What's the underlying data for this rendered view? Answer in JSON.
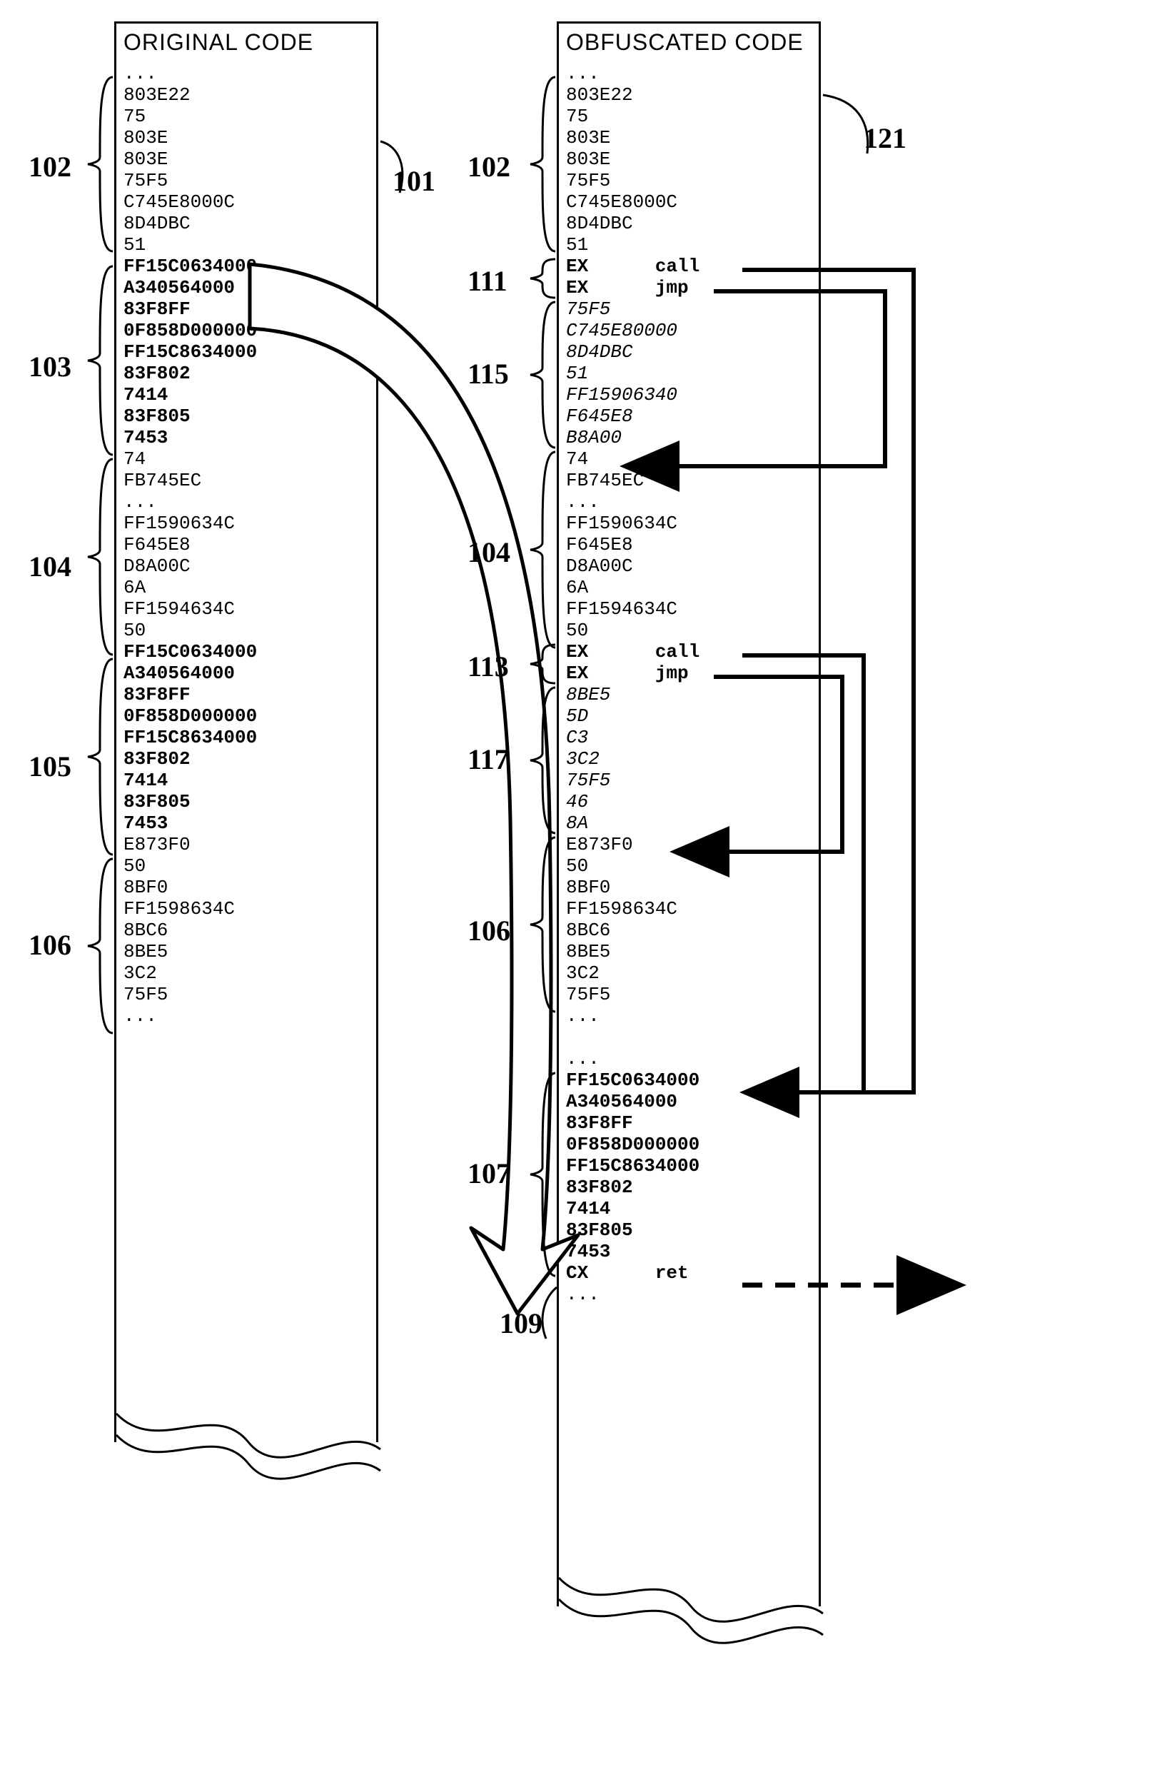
{
  "left_panel": {
    "title": "ORIGINAL CODE",
    "lines": [
      {
        "t": "...",
        "s": ""
      },
      {
        "t": "803E22",
        "s": ""
      },
      {
        "t": "75",
        "s": ""
      },
      {
        "t": "803E",
        "s": ""
      },
      {
        "t": "803E",
        "s": ""
      },
      {
        "t": "75F5",
        "s": ""
      },
      {
        "t": "C745E8000C",
        "s": ""
      },
      {
        "t": "8D4DBC",
        "s": ""
      },
      {
        "t": "51",
        "s": ""
      },
      {
        "t": "FF15C0634000",
        "s": "bold"
      },
      {
        "t": "A340564000",
        "s": "bold"
      },
      {
        "t": "83F8FF",
        "s": "bold"
      },
      {
        "t": "0F858D000000",
        "s": "bold"
      },
      {
        "t": "FF15C8634000",
        "s": "bold"
      },
      {
        "t": "83F802",
        "s": "bold"
      },
      {
        "t": "7414",
        "s": "bold"
      },
      {
        "t": "83F805",
        "s": "bold"
      },
      {
        "t": "7453",
        "s": "bold"
      },
      {
        "t": "74",
        "s": ""
      },
      {
        "t": "FB745EC",
        "s": ""
      },
      {
        "t": "...",
        "s": ""
      },
      {
        "t": "FF1590634C",
        "s": ""
      },
      {
        "t": "F645E8",
        "s": ""
      },
      {
        "t": "D8A00C",
        "s": ""
      },
      {
        "t": "6A",
        "s": ""
      },
      {
        "t": "FF1594634C",
        "s": ""
      },
      {
        "t": "50",
        "s": ""
      },
      {
        "t": "FF15C0634000",
        "s": "bold"
      },
      {
        "t": "A340564000",
        "s": "bold"
      },
      {
        "t": "83F8FF",
        "s": "bold"
      },
      {
        "t": "0F858D000000",
        "s": "bold"
      },
      {
        "t": "FF15C8634000",
        "s": "bold"
      },
      {
        "t": "83F802",
        "s": "bold"
      },
      {
        "t": "7414",
        "s": "bold"
      },
      {
        "t": "83F805",
        "s": "bold"
      },
      {
        "t": "7453",
        "s": "bold"
      },
      {
        "t": "E873F0",
        "s": ""
      },
      {
        "t": "50",
        "s": ""
      },
      {
        "t": "8BF0",
        "s": ""
      },
      {
        "t": "FF1598634C",
        "s": ""
      },
      {
        "t": "8BC6",
        "s": ""
      },
      {
        "t": "8BE5",
        "s": ""
      },
      {
        "t": "3C2",
        "s": ""
      },
      {
        "t": "75F5",
        "s": ""
      },
      {
        "t": "...",
        "s": ""
      }
    ]
  },
  "right_panel": {
    "title": "OBFUSCATED CODE",
    "lines": [
      {
        "t": "...",
        "s": ""
      },
      {
        "t": "803E22",
        "s": ""
      },
      {
        "t": "75",
        "s": ""
      },
      {
        "t": "803E",
        "s": ""
      },
      {
        "t": "803E",
        "s": ""
      },
      {
        "t": "75F5",
        "s": ""
      },
      {
        "t": "C745E8000C",
        "s": ""
      },
      {
        "t": "8D4DBC",
        "s": ""
      },
      {
        "t": "51",
        "s": ""
      },
      {
        "t": "EX      call",
        "s": "bold"
      },
      {
        "t": "EX      jmp",
        "s": "bold"
      },
      {
        "t": "75F5",
        "s": "italic"
      },
      {
        "t": "C745E80000",
        "s": "italic"
      },
      {
        "t": "8D4DBC",
        "s": "italic"
      },
      {
        "t": "51",
        "s": "italic"
      },
      {
        "t": "FF15906340",
        "s": "italic"
      },
      {
        "t": "F645E8",
        "s": "italic"
      },
      {
        "t": "B8A00",
        "s": "italic"
      },
      {
        "t": "74",
        "s": ""
      },
      {
        "t": "FB745EC",
        "s": ""
      },
      {
        "t": "...",
        "s": ""
      },
      {
        "t": "FF1590634C",
        "s": ""
      },
      {
        "t": "F645E8",
        "s": ""
      },
      {
        "t": "D8A00C",
        "s": ""
      },
      {
        "t": "6A",
        "s": ""
      },
      {
        "t": "FF1594634C",
        "s": ""
      },
      {
        "t": "50",
        "s": ""
      },
      {
        "t": "EX      call",
        "s": "bold"
      },
      {
        "t": "EX      jmp",
        "s": "bold"
      },
      {
        "t": "8BE5",
        "s": "italic"
      },
      {
        "t": "5D",
        "s": "italic"
      },
      {
        "t": "C3",
        "s": "italic"
      },
      {
        "t": "3C2",
        "s": "italic"
      },
      {
        "t": "75F5",
        "s": "italic"
      },
      {
        "t": "46",
        "s": "italic"
      },
      {
        "t": "8A",
        "s": "italic"
      },
      {
        "t": "E873F0",
        "s": ""
      },
      {
        "t": "50",
        "s": ""
      },
      {
        "t": "8BF0",
        "s": ""
      },
      {
        "t": "FF1598634C",
        "s": ""
      },
      {
        "t": "8BC6",
        "s": ""
      },
      {
        "t": "8BE5",
        "s": ""
      },
      {
        "t": "3C2",
        "s": ""
      },
      {
        "t": "75F5",
        "s": ""
      },
      {
        "t": "...",
        "s": ""
      },
      {
        "t": "",
        "s": ""
      },
      {
        "t": "...",
        "s": ""
      },
      {
        "t": "FF15C0634000",
        "s": "bold"
      },
      {
        "t": "A340564000",
        "s": "bold"
      },
      {
        "t": "83F8FF",
        "s": "bold"
      },
      {
        "t": "0F858D000000",
        "s": "bold"
      },
      {
        "t": "FF15C8634000",
        "s": "bold"
      },
      {
        "t": "83F802",
        "s": "bold"
      },
      {
        "t": "7414",
        "s": "bold"
      },
      {
        "t": "83F805",
        "s": "bold"
      },
      {
        "t": "7453",
        "s": "bold"
      },
      {
        "t": "CX      ret",
        "s": "bold"
      },
      {
        "t": "...",
        "s": ""
      }
    ]
  },
  "refs": {
    "r101": "101",
    "r102": "102",
    "r103": "103",
    "r104": "104",
    "r105": "105",
    "r106": "106",
    "r107": "107",
    "r109": "109",
    "r111": "111",
    "r113": "113",
    "r115": "115",
    "r117": "117",
    "r121": "121"
  }
}
